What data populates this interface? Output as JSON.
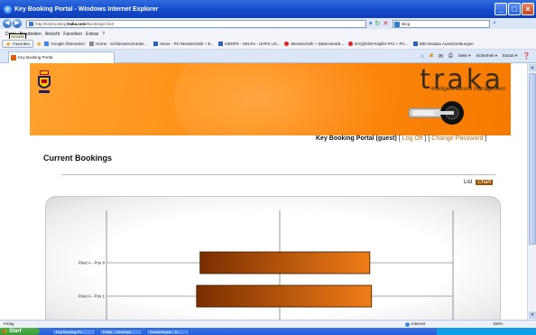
{
  "window": {
    "title": "Key Booking Portal - Windows Internet Explorer"
  },
  "address": {
    "url_prefix": "http://keybooking.",
    "url_domain": "traka.com",
    "url_suffix": "/BookingsChart",
    "search_text": "Bing"
  },
  "menu": {
    "items": [
      "Datei",
      "Bearbeiten",
      "Ansicht",
      "Favoriten",
      "Extras",
      "?"
    ],
    "tooltip": "Ansicht"
  },
  "favorites": {
    "button_label": "Favoriten",
    "links": [
      "Google Übersetzer",
      "Home - Schlüsselschranke ...",
      "Home - PC-Messtechnik + E...",
      "HEDPS - HELPA - UHFS US...",
      "Messtechnik + Datenverarb...",
      "DAQ/DSD-Käpfer-PCI + PC...",
      "IDB Neubau Ausschreibungen"
    ]
  },
  "tab": {
    "label": "Key Booking Portal"
  },
  "command_bar": {
    "items": [
      "Seite ▾",
      "Sicherheit ▾",
      "Extras ▾"
    ]
  },
  "banner": {
    "logo_text": "traka",
    "tagline": "intelligent access management"
  },
  "portal": {
    "label": "Key Booking Portal (guest)",
    "logoff": "Log Off",
    "change_password": "Change Password"
  },
  "page": {
    "title": "Current Bookings",
    "view_list": "List",
    "view_chart": "Chart"
  },
  "chart_data": {
    "type": "bar",
    "orientation": "horizontal",
    "title": "",
    "categories": [
      "Fleet A - Pos 8",
      "Fleet A - Pos 1"
    ],
    "series": [
      {
        "values": [
          [
            0.54,
            1.52
          ],
          [
            0.52,
            1.53
          ]
        ]
      }
    ],
    "x_ticks": [
      "",
      "",
      ""
    ],
    "bar_gradient": [
      "#7a2e00",
      "#f07d18"
    ],
    "grid": true
  },
  "status": {
    "left": "Fertig",
    "zone": "Internet",
    "zoom": "150%"
  },
  "taskbar": {
    "start": "Start",
    "tasks": [
      "Key Booking Po...",
      "Editor - Christoph...",
      "Sonderregeln - D..."
    ]
  }
}
